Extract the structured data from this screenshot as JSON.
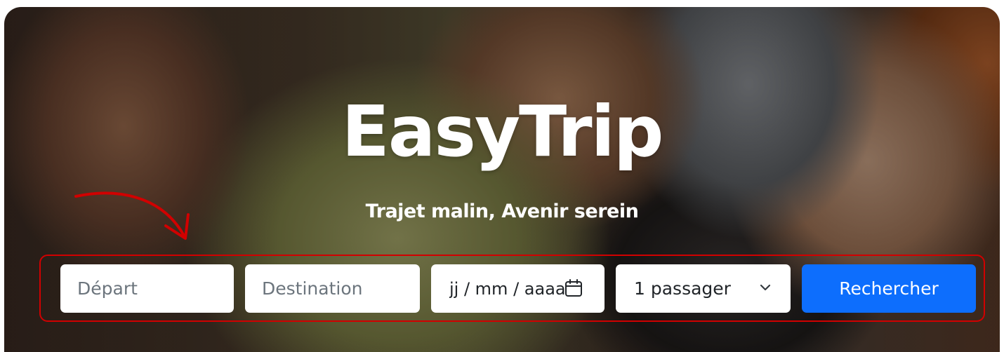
{
  "hero": {
    "title": "EasyTrip",
    "subtitle": "Trajet malin, Avenir serein"
  },
  "search": {
    "departure_placeholder": "Départ",
    "destination_placeholder": "Destination",
    "date_placeholder": "jj / mm / aaaa",
    "passengers_value": "1 passager",
    "submit_label": "Rechercher"
  },
  "icons": {
    "date": "calendar-icon",
    "passengers": "chevron-down-icon",
    "annotation": "curved-arrow-icon"
  },
  "colors": {
    "accent": "#0d6efd",
    "annotation": "#d10000",
    "text_on_hero": "#ffffff"
  }
}
